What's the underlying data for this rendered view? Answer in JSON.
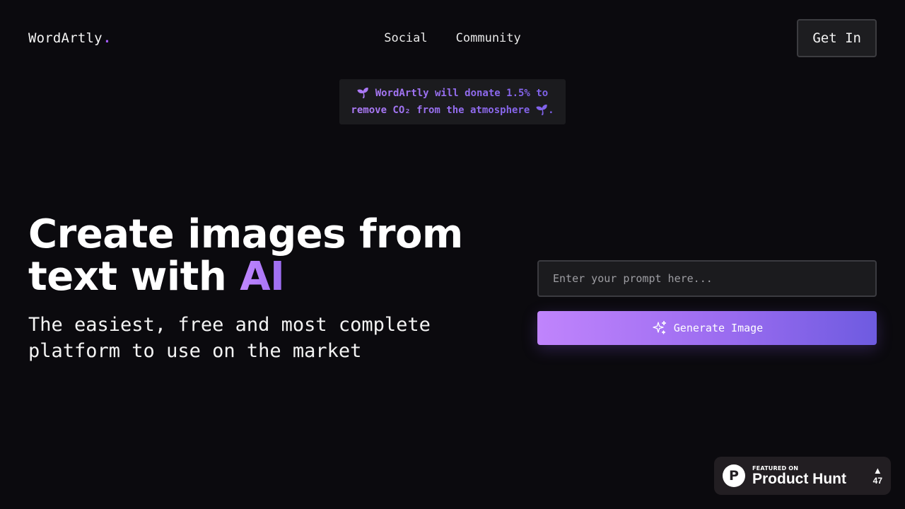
{
  "header": {
    "logo_text": "WordArtly",
    "logo_dot": ".",
    "nav": [
      {
        "label": "Social"
      },
      {
        "label": "Community"
      }
    ],
    "cta_label": "Get In"
  },
  "banner": {
    "text": "🌱 WordArtly will donate 1.5% to remove CO₂ from the atmosphere 🌱."
  },
  "hero": {
    "title_line1": "Create images from",
    "title_line2_prefix": "text with ",
    "title_highlight": "AI",
    "subtitle": "The easiest, free and most complete platform to use on the market"
  },
  "form": {
    "prompt_placeholder": "Enter your prompt here...",
    "prompt_value": "",
    "generate_label": "Generate Image",
    "generate_icon": "sparkle-icon"
  },
  "product_hunt": {
    "featured_label": "FEATURED ON",
    "name": "Product Hunt",
    "logo_letter": "P",
    "votes_arrow": "▲",
    "votes": "47"
  },
  "colors": {
    "background": "#0b0a0e",
    "accent_start": "#c084fc",
    "accent_end": "#6e5be0"
  }
}
